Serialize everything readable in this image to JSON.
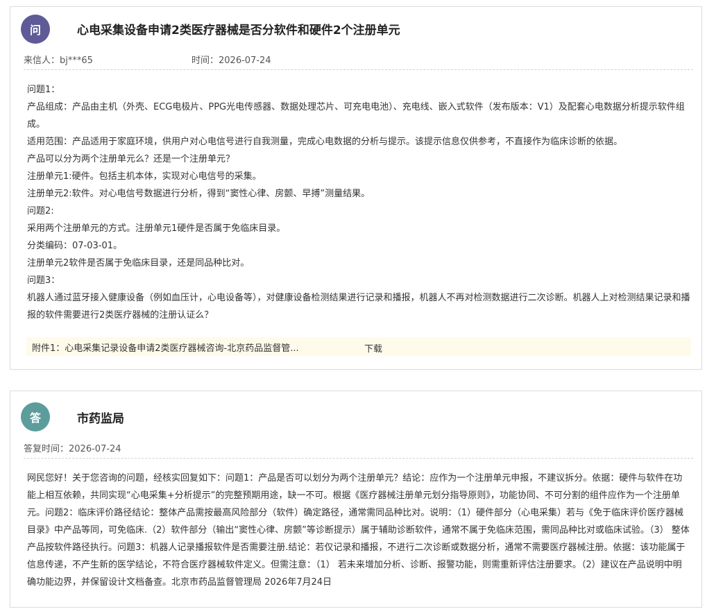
{
  "question": {
    "badge": "问",
    "title": "心电采集设备申请2类医疗器械是否分软件和硬件2个注册单元",
    "sender_label": "来信人：bj***65",
    "time_label": "时间：2026-07-24",
    "lines": [
      "问题1：",
      "产品组成：产品由主机（外壳、ECG电极片、PPG光电传感器、数据处理芯片、可充电电池）、充电线、嵌入式软件（发布版本：V1）及配套心电数据分析提示软件组成。",
      "适用范围：产品适用于家庭环境，供用户对心电信号进行自我测量，完成心电数据的分析与提示。该提示信息仅供参考，不直接作为临床诊断的依据。",
      "产品可以分为两个注册单元么？还是一个注册单元？",
      "注册单元1:硬件。包括主机本体，实现对心电信号的采集。",
      "注册单元2:软件。对心电信号数据进行分析，得到“窦性心律、房颤、早搏”测量结果。",
      "问题2:",
      "采用两个注册单元的方式。注册单元1硬件是否属于免临床目录。",
      "分类编码：07-03-01。",
      "注册单元2软件是否属于免临床目录，还是同品种比对。",
      "问题3：",
      "机器人通过蓝牙接入健康设备（例如血压计，心电设备等），对健康设备检测结果进行记录和播报，机器人不再对检测数据进行二次诊断。机器人上对检测结果记录和播报的软件需要进行2类医疗器械的注册认证么？"
    ],
    "attachment": {
      "name": "附件1：心电采集记录设备申请2类医疗器械咨询-北京药品监督管...",
      "download_label": "下载"
    }
  },
  "answer": {
    "badge": "答",
    "title": "市药监局",
    "reply_time_label": "答复时间：2026-07-24",
    "text": "网民您好！关于您咨询的问题，经核实回复如下：问题1：产品是否可以划分为两个注册单元？结论：应作为一个注册单元申报，不建议拆分。依据：硬件与软件在功能上相互依赖，共同实现“心电采集+分析提示”的完整预期用途，缺一不可。根据《医疗器械注册单元划分指导原则》，功能协同、不可分割的组件应作为一个注册单元。问题2：临床评价路径结论：整体产品需按最高风险部分（软件）确定路径，通常需同品种比对。说明：（1）硬件部分（心电采集）若与《免于临床评价医疗器械目录》中产品等同，可免临床.（2）软件部分（输出“窦性心律、房颤”等诊断提示）属于辅助诊断软件，通常不属于免临床范围，需同品种比对或临床试验。（3） 整体产品按软件路径执行。问题3：机器人记录播报软件是否需要注册.结论：若仅记录和播报，不进行二次诊断或数据分析，通常不需要医疗器械注册。依据：该功能属于信息传递，不产生新的医学结论，不符合医疗器械软件定义。但需注意：（1） 若未来增加分析、诊断、报警功能，则需重新评估注册要求。（2）建议在产品说明中明确功能边界，并保留设计文档备查。北京市药品监督管理局 2026年7月24日"
  }
}
